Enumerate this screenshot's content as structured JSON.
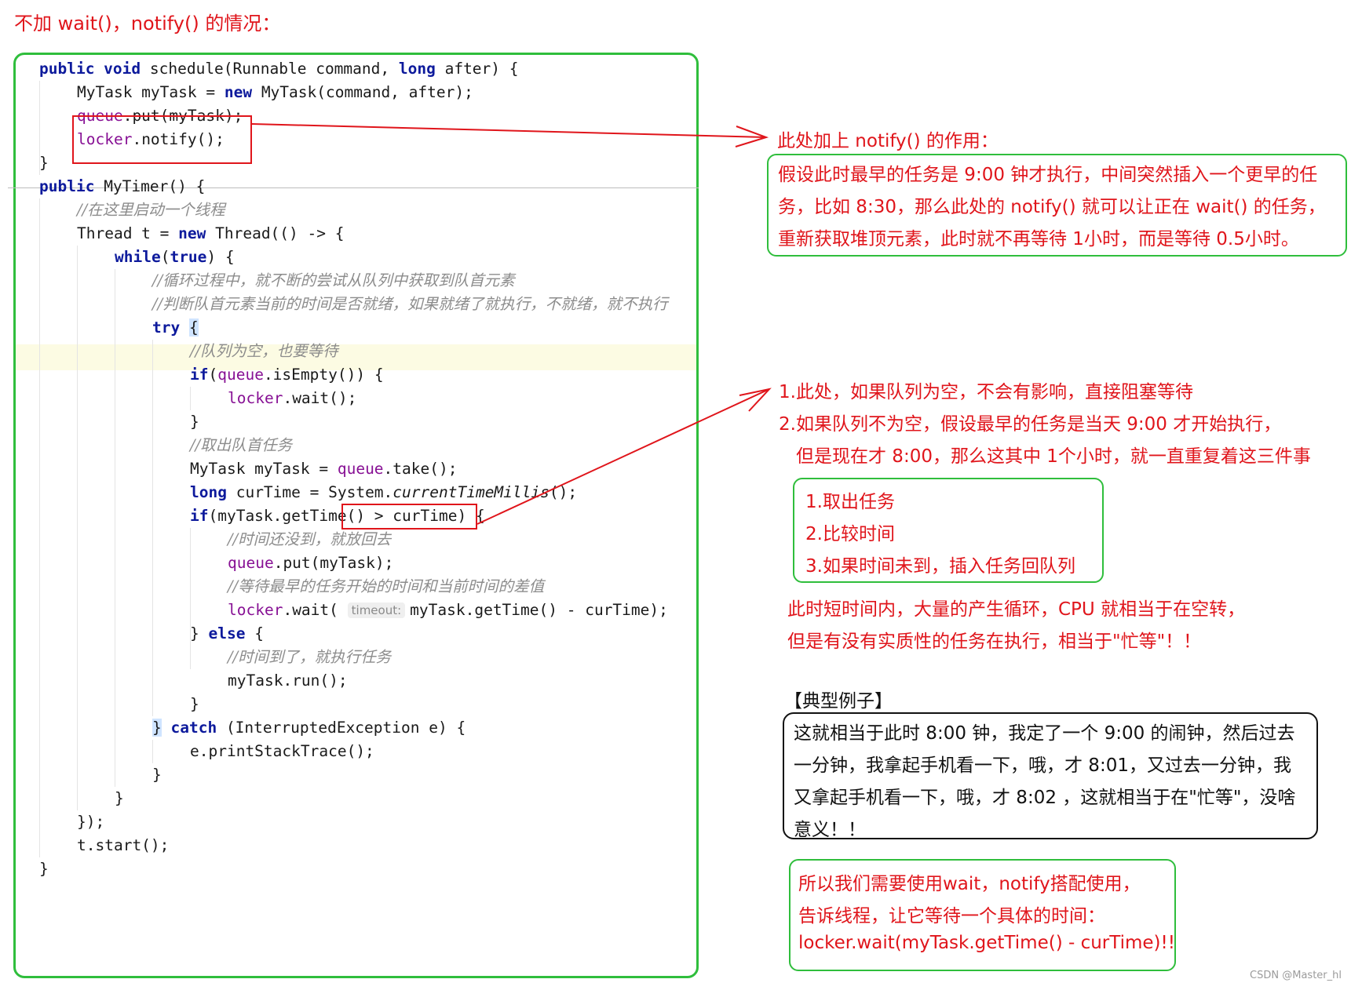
{
  "title": "不加 wait()，notify() 的情况：",
  "code_lines": [
    [
      {
        "t": "public void",
        "k": "kw"
      },
      {
        "t": " schedule(Runnable command, "
      },
      {
        "t": "long",
        "k": "kw"
      },
      {
        "t": " after) {"
      }
    ],
    [
      {
        "t": "MyTask myTask = "
      },
      {
        "t": "new",
        "k": "kw"
      },
      {
        "t": " MyTask(command, after);"
      }
    ],
    [
      {
        "t": "queue",
        "k": "field"
      },
      {
        "t": ".put(myTask);"
      }
    ],
    [
      {
        "t": "locker",
        "k": "field"
      },
      {
        "t": ".notify();"
      }
    ],
    [
      {
        "t": "}"
      }
    ],
    [
      {
        "t": "public",
        "k": "kw"
      },
      {
        "t": " MyTimer() {"
      }
    ],
    [
      {
        "t": "//在这里启动一个线程",
        "k": "comment"
      }
    ],
    [
      {
        "t": "Thread t = "
      },
      {
        "t": "new",
        "k": "kw"
      },
      {
        "t": " Thread(() -> {"
      }
    ],
    [
      {
        "t": "while",
        "k": "kw"
      },
      {
        "t": "("
      },
      {
        "t": "true",
        "k": "kw"
      },
      {
        "t": ") {"
      }
    ],
    [
      {
        "t": "//循环过程中，就不断的尝试从队列中获取到队首元素",
        "k": "comment"
      }
    ],
    [
      {
        "t": "//判断队首元素当前的时间是否就绪，如果就绪了就执行，不就绪，就不执行",
        "k": "comment"
      }
    ],
    [
      {
        "t": "try",
        "k": "kw"
      },
      {
        "t": " "
      },
      {
        "t": "{",
        "k": "brace"
      }
    ],
    [
      {
        "t": "//队列为空，也要等待",
        "k": "comment"
      }
    ],
    [
      {
        "t": "if",
        "k": "kw"
      },
      {
        "t": "("
      },
      {
        "t": "queue",
        "k": "field"
      },
      {
        "t": ".isEmpty()) {"
      }
    ],
    [
      {
        "t": "locker",
        "k": "field"
      },
      {
        "t": ".wait();"
      }
    ],
    [
      {
        "t": "}"
      }
    ],
    [
      {
        "t": "//取出队首任务",
        "k": "comment"
      }
    ],
    [
      {
        "t": "MyTask myTask = "
      },
      {
        "t": "queue",
        "k": "field"
      },
      {
        "t": ".take();"
      }
    ],
    [
      {
        "t": "long",
        "k": "kw"
      },
      {
        "t": " curTime = System."
      },
      {
        "t": "currentTimeMillis",
        "k": "italic"
      },
      {
        "t": "();"
      }
    ],
    [
      {
        "t": "if",
        "k": "kw"
      },
      {
        "t": "(myTask.getTime() > curTime) {"
      }
    ],
    [
      {
        "t": "//时间还没到，就放回去",
        "k": "comment"
      }
    ],
    [
      {
        "t": "queue",
        "k": "field"
      },
      {
        "t": ".put(myTask);"
      }
    ],
    [
      {
        "t": "//等待最早的任务开始的时间和当前时间的差值",
        "k": "comment"
      }
    ],
    [
      {
        "t": "locker",
        "k": "field"
      },
      {
        "t": ".wait( "
      },
      {
        "t": "timeout:",
        "k": "hint"
      },
      {
        "t": "myTask.getTime() - curTime);"
      }
    ],
    [
      {
        "t": "} "
      },
      {
        "t": "else",
        "k": "kw"
      },
      {
        "t": " {"
      }
    ],
    [
      {
        "t": "//时间到了，就执行任务",
        "k": "comment"
      }
    ],
    [
      {
        "t": "myTask.run();"
      }
    ],
    [
      {
        "t": "}"
      }
    ],
    [
      {
        "t": "}",
        "k": "brace"
      },
      {
        "t": " "
      },
      {
        "t": "catch",
        "k": "kw"
      },
      {
        "t": " (InterruptedException e) {"
      }
    ],
    [
      {
        "t": "e.printStackTrace();"
      }
    ],
    [
      {
        "t": "}"
      }
    ],
    [
      {
        "t": "}"
      }
    ],
    [
      {
        "t": "});"
      }
    ],
    [
      {
        "t": "t.start();"
      }
    ],
    [
      {
        "t": "}"
      }
    ]
  ],
  "notify_note": {
    "heading": "此处加上 notify() 的作用：",
    "lines": [
      "假设此时最早的任务是 9:00 钟才执行，中间突然插入一个更早的任",
      "务，比如 8:30，那么此处的 notify() 就可以让正在 wait() 的任务，",
      "重新获取堆顶元素，此时就不再等待 1小时，而是等待 0.5小时。"
    ]
  },
  "take_note": {
    "lines": [
      "1.此处，如果队列为空，不会有影响，直接阻塞等待",
      "2.如果队列不为空，假设最早的任务是当天 9:00 才开始执行，",
      "但是现在才 8:00，那么这其中 1个小时，就一直重复着这三件事"
    ],
    "steps": [
      "1.取出任务",
      "2.比较时间",
      "3.如果时间未到，插入任务回队列"
    ],
    "busy": [
      "此时短时间内，大量的产生循环，CPU 就相当于在空转，",
      "但是有没有实质性的任务在执行，相当于\"忙等\"！！"
    ]
  },
  "example": {
    "heading": "【典型例子】",
    "lines": [
      "这就相当于此时 8:00 钟，我定了一个 9:00 的闹钟，然后过去",
      "一分钟，我拿起手机看一下，哦，才 8:01，又过去一分钟，我",
      "又拿起手机看一下，哦，才 8:02 ，这就相当于在\"忙等\"，没啥",
      "意义！！"
    ]
  },
  "conclusion": {
    "lines": [
      "所以我们需要使用wait，notify搭配使用，",
      "告诉线程，让它等待一个具体的时间：",
      "locker.wait(myTask.getTime() - curTime)!!"
    ]
  },
  "watermark": "CSDN @Master_hl",
  "colors": {
    "annotation_red": "#e0151b",
    "box_green": "#2fbe3c",
    "keyword": "#0d1a9c",
    "field": "#871094",
    "comment": "#8c8c8c"
  }
}
